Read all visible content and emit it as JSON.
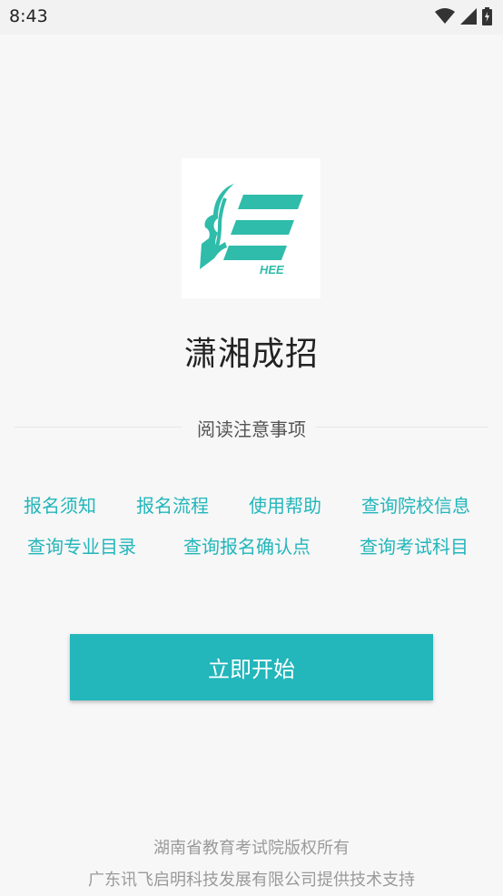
{
  "status_bar": {
    "time": "8:43",
    "icons": [
      "wifi-icon",
      "signal-icon",
      "battery-icon"
    ]
  },
  "logo": {
    "text": "HEE",
    "color": "#2fbcaa"
  },
  "app_title": "潇湘成招",
  "notice": {
    "title": "阅读注意事项",
    "links_row1": [
      "报名须知",
      "报名流程",
      "使用帮助",
      "查询院校信息"
    ],
    "links_row2": [
      "查询专业目录",
      "查询报名确认点",
      "查询考试科目"
    ]
  },
  "start_button": "立即开始",
  "footer": {
    "line1": "湖南省教育考试院版权所有",
    "line2": "广东讯飞启明科技发展有限公司提供技术支持"
  },
  "colors": {
    "accent": "#23b6bb",
    "background": "#f7f7f7"
  }
}
